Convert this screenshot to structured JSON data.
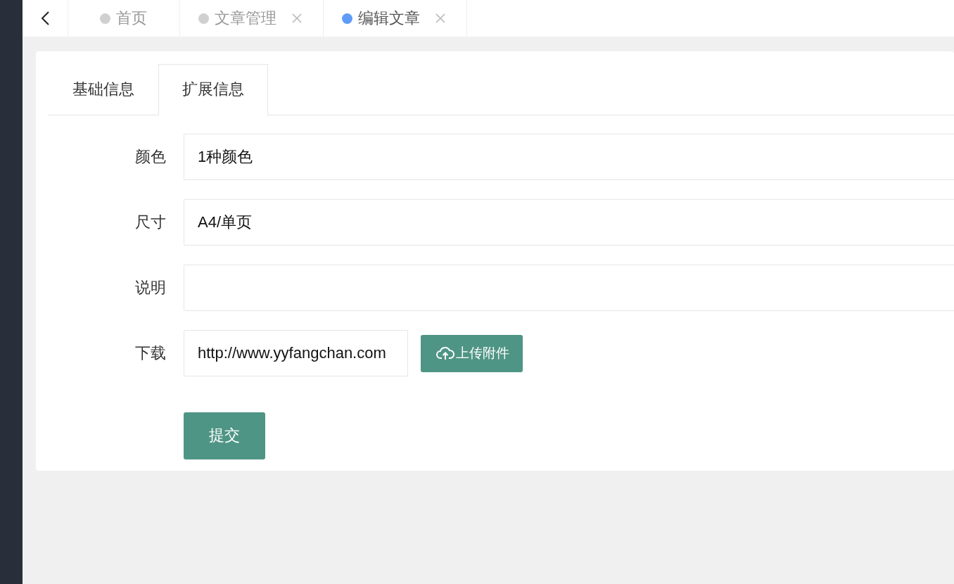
{
  "page_tabs": [
    {
      "label": "首页",
      "selected": false,
      "closable": false
    },
    {
      "label": "文章管理",
      "selected": false,
      "closable": true
    },
    {
      "label": "编辑文章",
      "selected": true,
      "closable": true
    }
  ],
  "form_tabs": [
    {
      "label": "基础信息",
      "selected": false
    },
    {
      "label": "扩展信息",
      "selected": true
    }
  ],
  "fields": [
    {
      "kind": "text",
      "label": "颜色",
      "value": "1种颜色"
    },
    {
      "kind": "text",
      "label": "尺寸",
      "value": "A4/单页"
    },
    {
      "kind": "text",
      "label": "说明"
    },
    {
      "kind": "upload",
      "label": "下载",
      "value": "http://www.yyfangchan.com",
      "button": "上传附件"
    }
  ],
  "submit": "提交"
}
